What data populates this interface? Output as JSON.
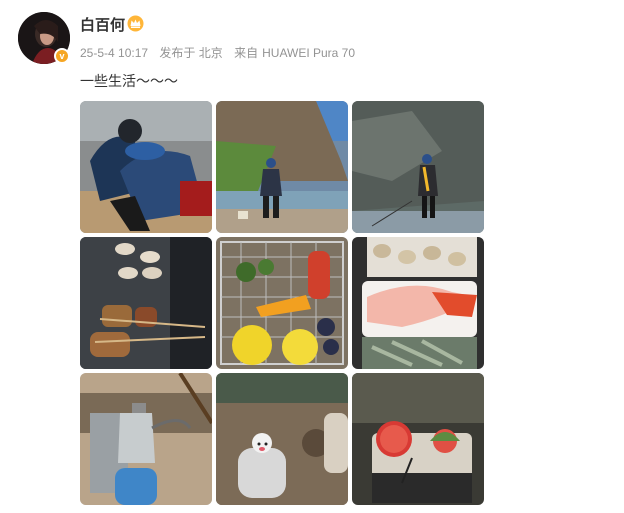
{
  "user": {
    "name": "白百何",
    "avatar_icon": "avatar-portrait",
    "verified_icon": "vip-badge-icon",
    "crown_icon": "crown-icon"
  },
  "meta": {
    "date": "25-5-4 10:17",
    "location": "发布于 北京",
    "source_prefix": "来自",
    "device": "HUAWEI Pura 70"
  },
  "post": {
    "text": "一些生活～～～"
  },
  "photos": [
    {
      "id": 1,
      "subject": "people crouching by rocks"
    },
    {
      "id": 2,
      "subject": "person by river under cliff"
    },
    {
      "id": 3,
      "subject": "person fishing by rock wall"
    },
    {
      "id": 4,
      "subject": "grilled scallops and skewers"
    },
    {
      "id": 5,
      "subject": "vegetables on grill basket"
    },
    {
      "id": 6,
      "subject": "seafood platter with shellfish"
    },
    {
      "id": 7,
      "subject": "kettle on camping stove"
    },
    {
      "id": 8,
      "subject": "soil with small figurine"
    },
    {
      "id": 9,
      "subject": "watermelon slices on cooler"
    }
  ],
  "colors": {
    "accent_orange": "#f6a623",
    "meta_gray": "#939393"
  }
}
